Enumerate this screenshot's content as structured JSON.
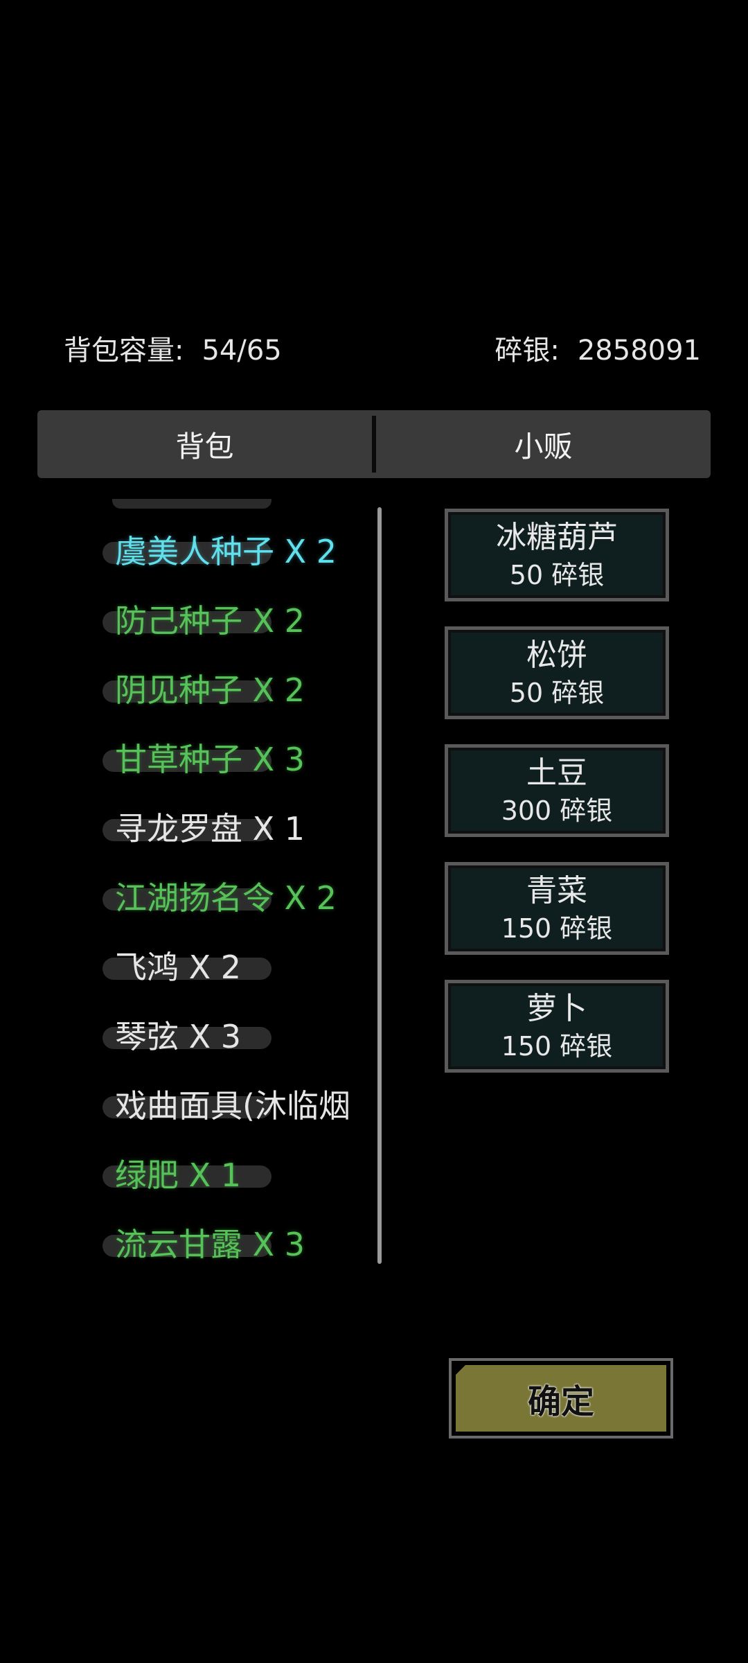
{
  "header": {
    "capacity_label": "背包容量:",
    "capacity_value": "54/65",
    "money_label": "碎银:",
    "money_value": "2858091"
  },
  "tabs": [
    {
      "label": "背包"
    },
    {
      "label": "小贩"
    }
  ],
  "inventory": {
    "items": [
      {
        "text": "虞美人种子 X 2",
        "color": "#5fe0ea"
      },
      {
        "text": "防己种子 X 2",
        "color": "#58c25a"
      },
      {
        "text": "阴见种子 X 2",
        "color": "#58c25a"
      },
      {
        "text": "甘草种子 X 3",
        "color": "#58c25a"
      },
      {
        "text": "寻龙罗盘 X 1",
        "color": "#e6e6e6"
      },
      {
        "text": "江湖扬名令 X 2",
        "color": "#58c25a"
      },
      {
        "text": "飞鸿 X 2",
        "color": "#e6e6e6"
      },
      {
        "text": "琴弦 X 3",
        "color": "#e6e6e6"
      },
      {
        "text": "戏曲面具(沐临烟",
        "color": "#e6e6e6"
      },
      {
        "text": "绿肥 X 1",
        "color": "#58c25a"
      },
      {
        "text": "流云甘露 X 3",
        "color": "#58c25a"
      }
    ]
  },
  "shop": {
    "items": [
      {
        "name": "冰糖葫芦",
        "price": "50 碎银"
      },
      {
        "name": "松饼",
        "price": "50 碎银"
      },
      {
        "name": "土豆",
        "price": "300 碎银"
      },
      {
        "name": "青菜",
        "price": "150 碎银"
      },
      {
        "name": "萝卜",
        "price": "150 碎银"
      }
    ]
  },
  "confirm_label": "确定"
}
